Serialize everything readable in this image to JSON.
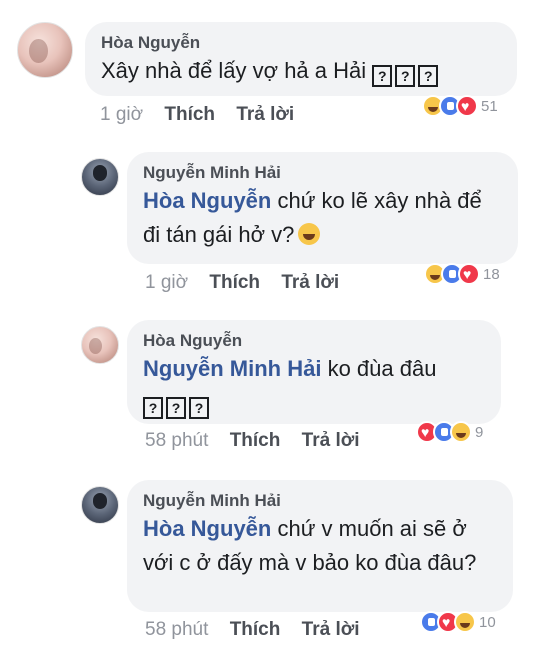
{
  "comments": [
    {
      "author": "Hòa Nguyễn",
      "text": "Xây nhà để lấy vợ hả a Hải",
      "qboxes": [
        "?",
        "?",
        "?"
      ],
      "time": "1 giờ",
      "like_label": "Thích",
      "reply_label": "Trả lời",
      "reactions": [
        "haha",
        "like",
        "love"
      ],
      "reaction_count": "51"
    },
    {
      "author": "Nguyễn Minh Hải",
      "mention": "Hòa Nguyễn",
      "text": " chứ ko lẽ xây nhà để đi tán gái hở v?",
      "emoji": "laughing-tears",
      "time": "1 giờ",
      "like_label": "Thích",
      "reply_label": "Trả lời",
      "reactions": [
        "haha",
        "like",
        "love"
      ],
      "reaction_count": "18"
    },
    {
      "author": "Hòa Nguyễn",
      "mention": "Nguyễn Minh Hải",
      "text": " ko đùa đâu",
      "qboxes": [
        "?",
        "?",
        "?"
      ],
      "time": "58 phút",
      "like_label": "Thích",
      "reply_label": "Trả lời",
      "reactions": [
        "love",
        "like",
        "haha"
      ],
      "reaction_count": "9"
    },
    {
      "author": "Nguyễn Minh Hải",
      "mention": "Hòa Nguyễn",
      "text": " chứ v muốn ai sẽ ở với c ở đấy mà v bảo ko đùa đâu?",
      "time": "58 phút",
      "like_label": "Thích",
      "reply_label": "Trả lời",
      "reactions": [
        "like",
        "love",
        "haha"
      ],
      "reaction_count": "10"
    }
  ]
}
